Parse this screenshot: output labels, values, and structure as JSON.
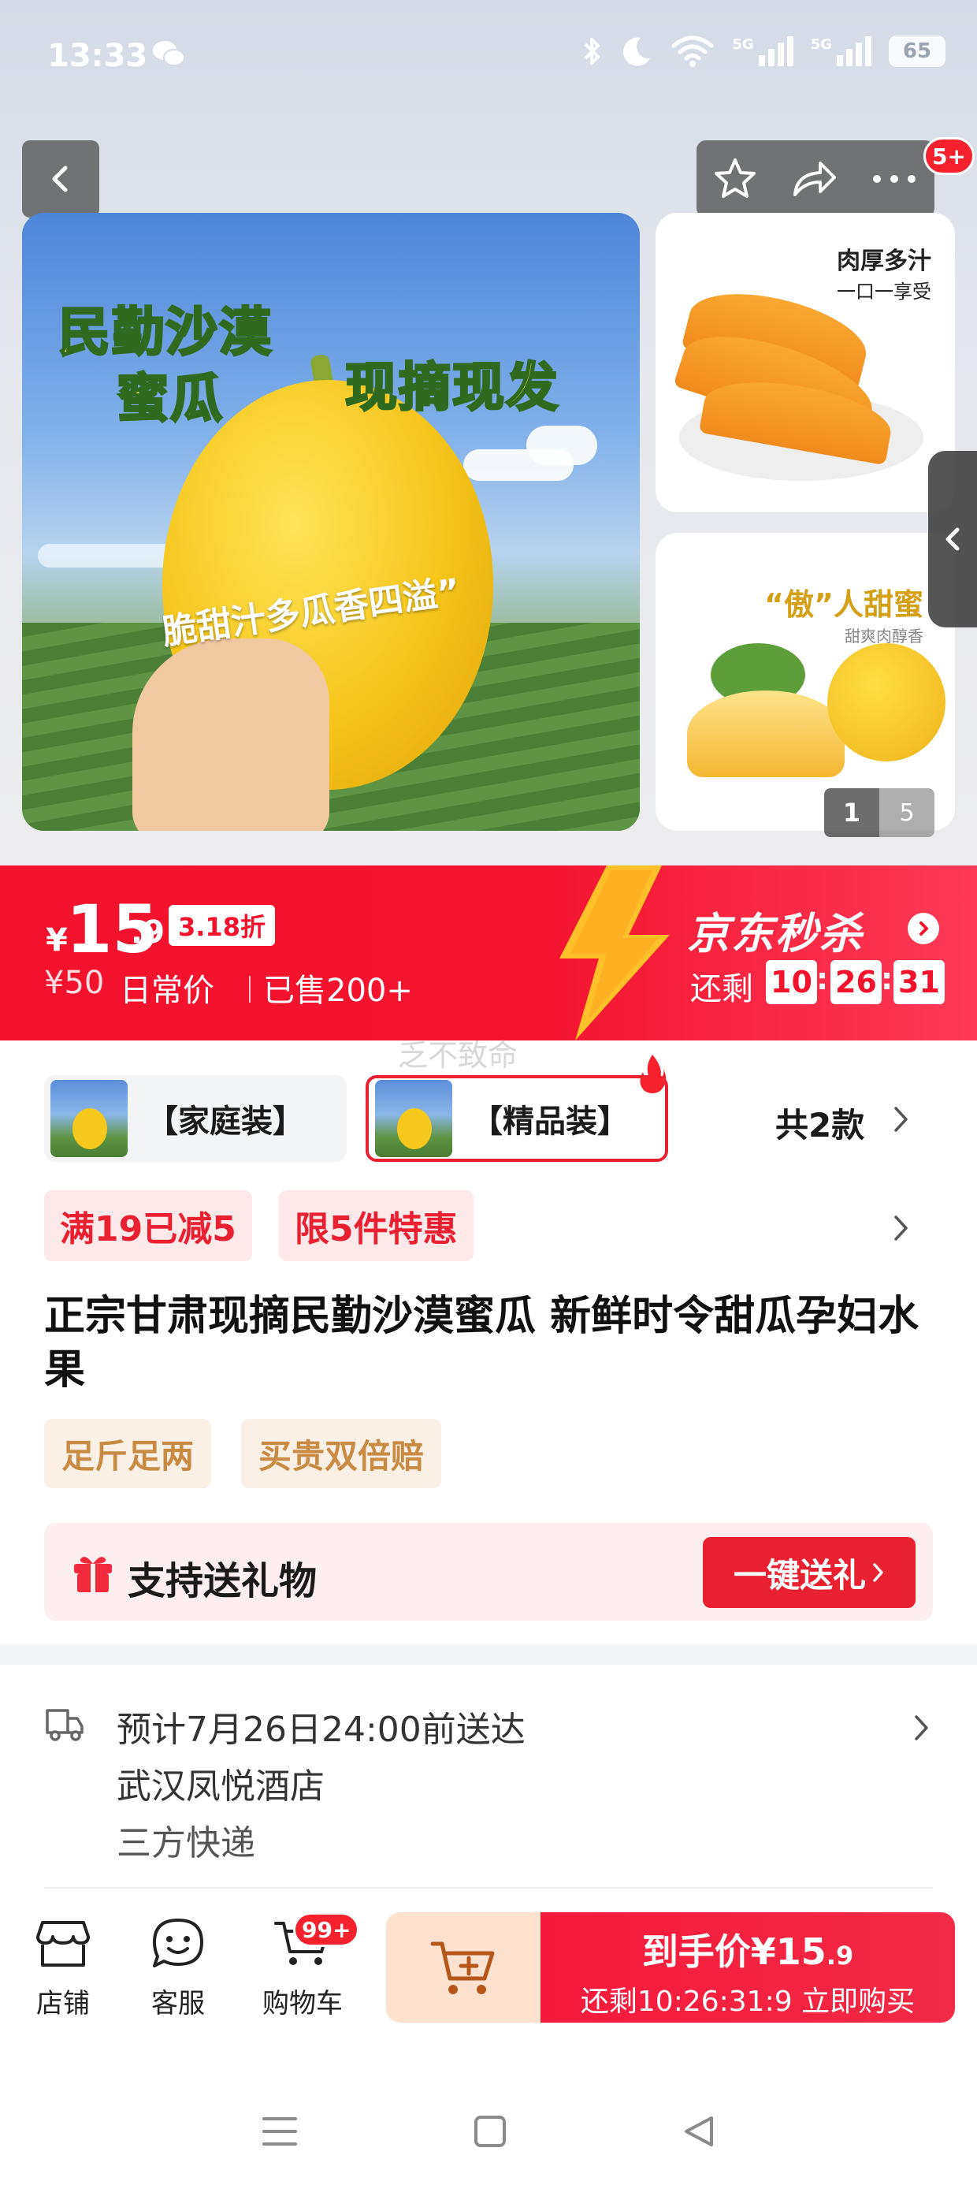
{
  "status_bar": {
    "time": "13:33",
    "network_label": "5G",
    "battery": "65"
  },
  "nav": {
    "badge": "5+"
  },
  "gallery": {
    "main_headline_1": "民勤沙漠",
    "main_headline_2": "蜜瓜",
    "main_headline_3": "现摘现发",
    "main_slogan": "脆甜汁多瓜香四溢”",
    "side1_caption_a": "肉厚多汁",
    "side1_caption_b": "一口一享受",
    "side2_caption_a": "“傲”人甜蜜",
    "side2_caption_b": "甜爽肉醇香",
    "counter_current": "1",
    "counter_total": "5"
  },
  "price": {
    "currency": "¥",
    "integer": "15",
    "decimal": ".9",
    "discount": "3.18折",
    "original": "¥50",
    "original_label": "日常价",
    "sold": "已售200+",
    "flash_title": "京东秒杀",
    "remain_label": "还剩",
    "hours": "10",
    "minutes": "26",
    "seconds": "31"
  },
  "watermark": "乏不致命",
  "variants": {
    "items": [
      {
        "label": "【家庭装】"
      },
      {
        "label": "【精品装】"
      }
    ],
    "total": "共2款"
  },
  "promos": [
    "满19已减5",
    "限5件特惠"
  ],
  "product": {
    "title": "正宗甘肃现摘民勤沙漠蜜瓜 新鲜时令甜瓜孕妇水果",
    "tags": [
      "足斤足两",
      "买贵双倍赔"
    ]
  },
  "gift": {
    "text": "支持送礼物",
    "button": "一键送礼"
  },
  "shipping": {
    "eta": "预计7月26日24:00前送达",
    "address": "武汉凤悦酒店",
    "carrier": "三方快递"
  },
  "bottom_bar": {
    "store": "店铺",
    "service": "客服",
    "cart": "购物车",
    "cart_badge": "99+",
    "buy_price_label": "到手价¥15",
    "buy_price_decimal": ".9",
    "buy_countdown": "还剩10:26:31:9 立即购买"
  },
  "colors": {
    "accent": "#f3122c",
    "tag_bg": "#fbf0e6",
    "tag_text": "#c98a43"
  }
}
